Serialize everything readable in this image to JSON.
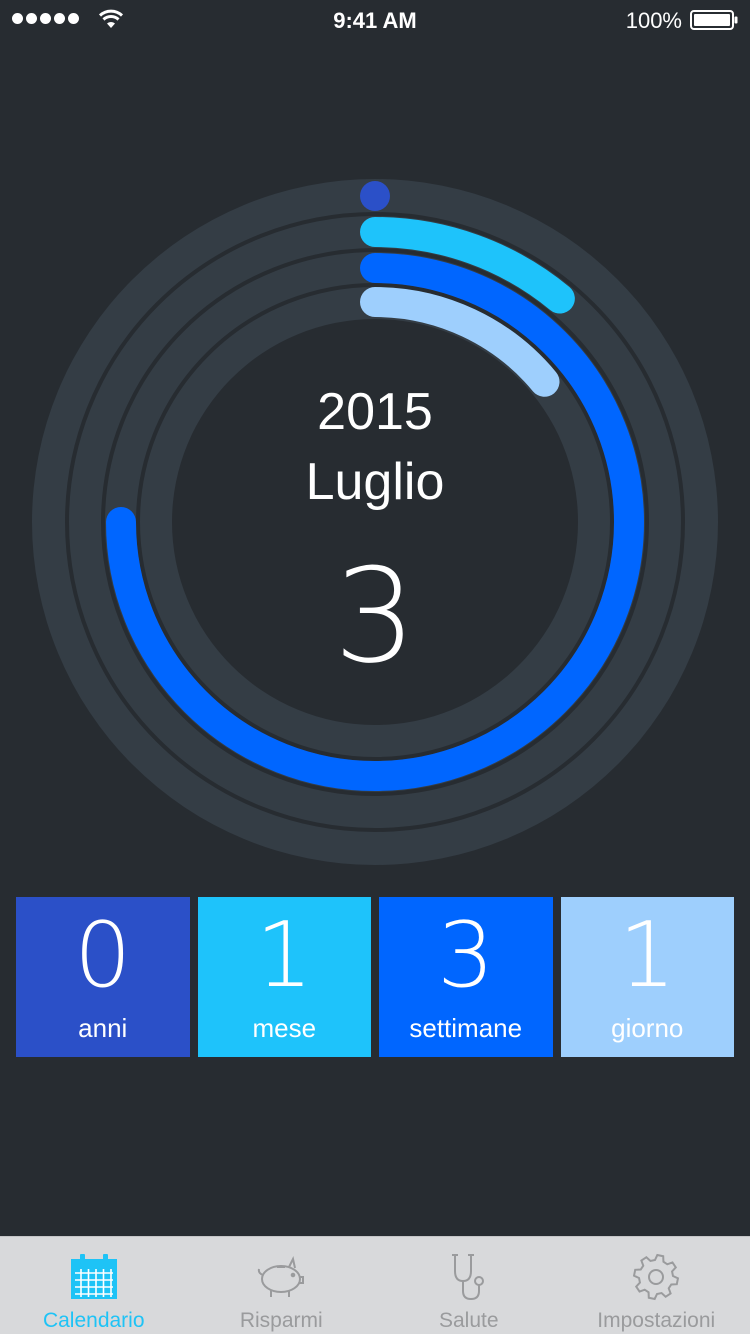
{
  "status_bar": {
    "time": "9:41 AM",
    "battery": "100%"
  },
  "summary": {
    "year": "2015",
    "month": "Luglio",
    "day": "3"
  },
  "rings": [
    {
      "name": "anni",
      "color": "#2b50c8",
      "progress": 0.0
    },
    {
      "name": "mese",
      "color": "#1ec3fb",
      "progress": 0.11
    },
    {
      "name": "settimane",
      "color": "#0066ff",
      "progress": 0.75
    },
    {
      "name": "giorno",
      "color": "#9ecffd",
      "progress": 0.14
    }
  ],
  "tiles": [
    {
      "value": "0",
      "label": "anni",
      "color": "#2b50c8"
    },
    {
      "value": "1",
      "label": "mese",
      "color": "#1ec3fb"
    },
    {
      "value": "3",
      "label": "settimane",
      "color": "#0066ff"
    },
    {
      "value": "1",
      "label": "giorno",
      "color": "#9ecffd"
    }
  ],
  "tab_bar": {
    "items": [
      {
        "label": "Calendario",
        "icon": "calendar-icon",
        "active": true
      },
      {
        "label": "Risparmi",
        "icon": "piggy-bank-icon",
        "active": false
      },
      {
        "label": "Salute",
        "icon": "stethoscope-icon",
        "active": false
      },
      {
        "label": "Impostazioni",
        "icon": "gear-icon",
        "active": false
      }
    ]
  },
  "colors": {
    "background": "#272c31",
    "track": "#343d45",
    "tab_bar_bg": "#d8d9db",
    "tab_active": "#1ec3f6",
    "tab_inactive": "#9a9b9d"
  }
}
